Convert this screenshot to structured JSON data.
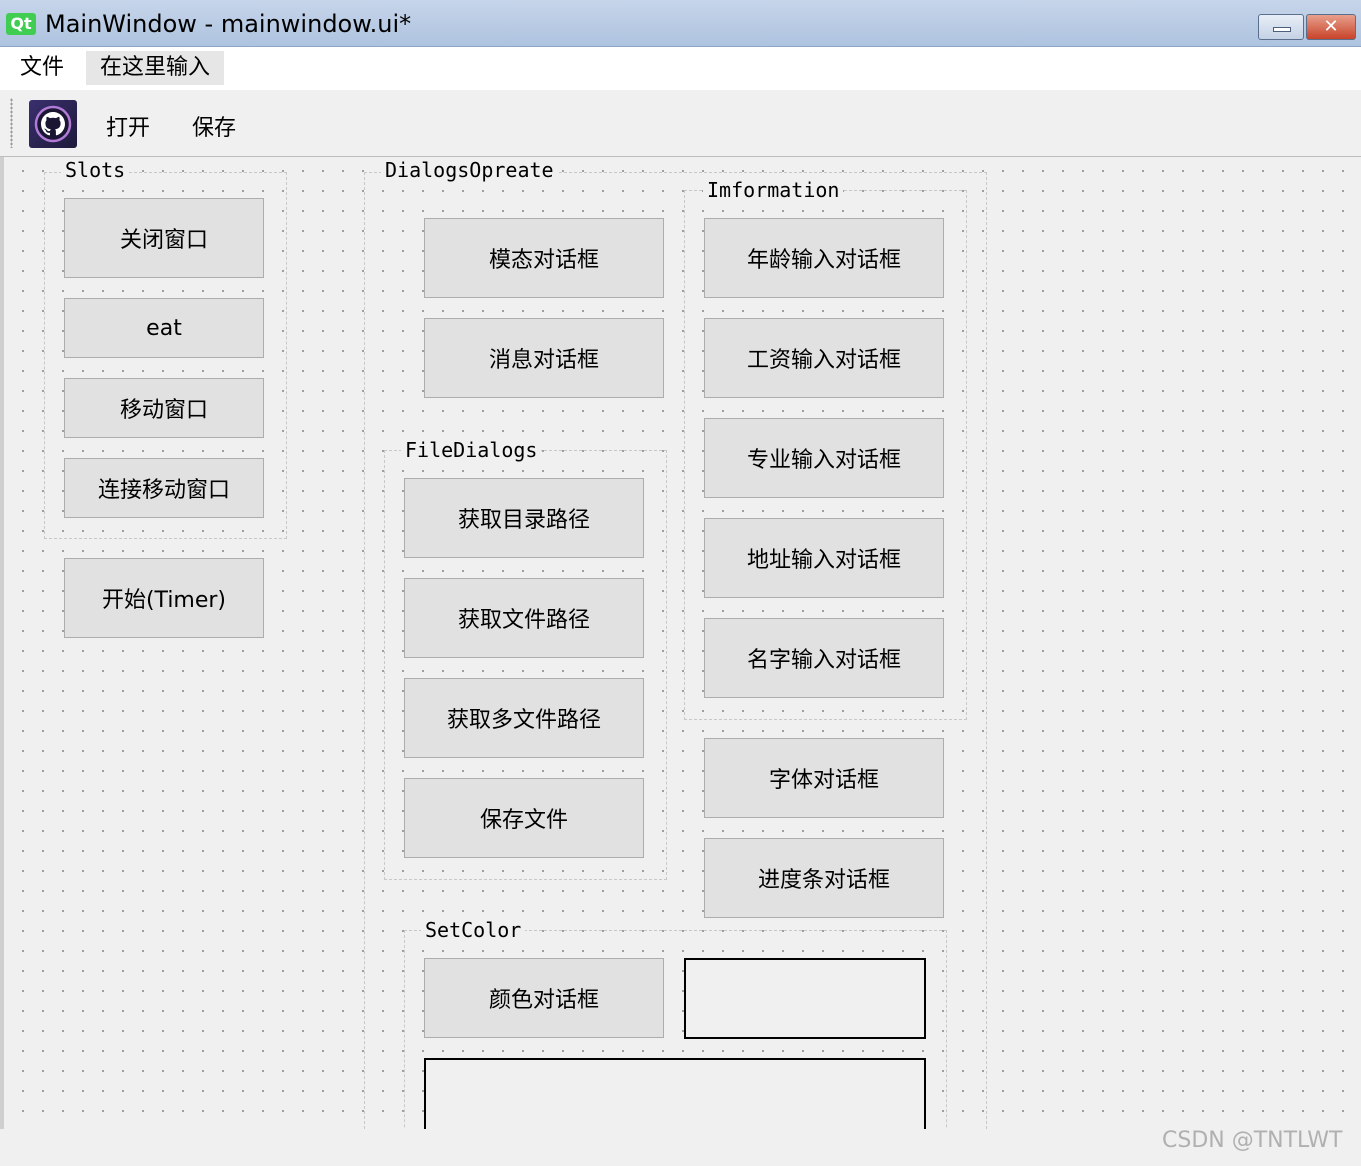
{
  "window": {
    "title": "MainWindow - mainwindow.ui*",
    "close_glyph": "✕"
  },
  "menubar": {
    "items": [
      {
        "label": "文件"
      },
      {
        "label": "在这里输入"
      }
    ]
  },
  "toolbar": {
    "icon": "github-icon",
    "open_label": "打开",
    "save_label": "保存"
  },
  "groups": {
    "slots": {
      "title": "Slots",
      "buttons": [
        "关闭窗口",
        "eat",
        "移动窗口",
        "连接移动窗口"
      ]
    },
    "timer_button": "开始(Timer)",
    "dialogs": {
      "title": "DialogsOpreate",
      "buttons": [
        "模态对话框",
        "消息对话框"
      ]
    },
    "file_dialogs": {
      "title": "FileDialogs",
      "buttons": [
        "获取目录路径",
        "获取文件路径",
        "获取多文件路径",
        "保存文件"
      ]
    },
    "information": {
      "title": "Imformation",
      "buttons": [
        "年龄输入对话框",
        "工资输入对话框",
        "专业输入对话框",
        "地址输入对话框",
        "名字输入对话框"
      ]
    },
    "extra_buttons": [
      "字体对话框",
      "进度条对话框"
    ],
    "set_color": {
      "title": "SetColor",
      "button": "颜色对话框"
    }
  },
  "watermark": "CSDN @TNTLWT",
  "colors": {
    "title_bar": "#aec3df",
    "qt_logo": "#41cd52",
    "close_button": "#c8432a",
    "button_face": "#e1e1e1"
  }
}
